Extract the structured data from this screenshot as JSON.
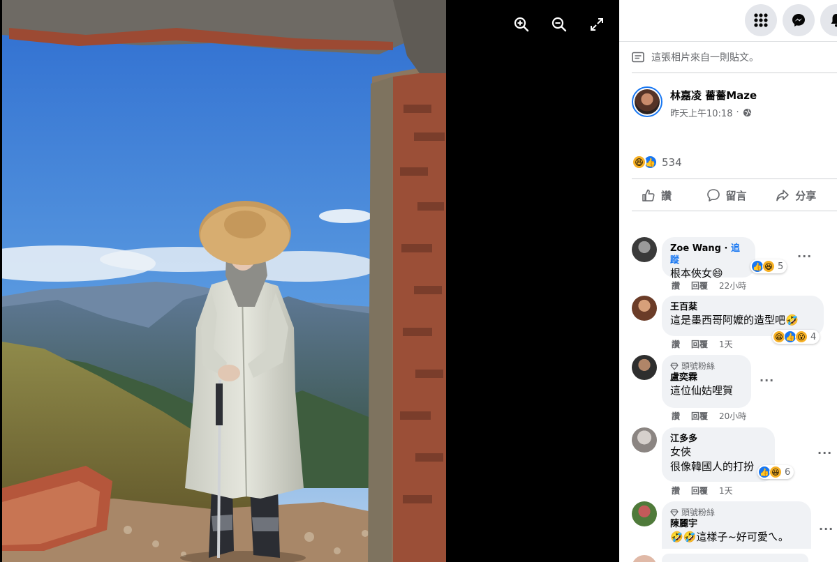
{
  "colors": {
    "accent": "#1877f2",
    "panel_bg": "#ffffff",
    "viewer_bg": "#000000",
    "muted": "#65676b"
  },
  "viewer": {
    "zoom_in_icon": "zoom-in-icon",
    "zoom_out_icon": "zoom-out-icon",
    "fullscreen_icon": "fullscreen-icon"
  },
  "topbar": {
    "icons": [
      "menu-grid-icon",
      "messenger-icon",
      "bell-icon"
    ]
  },
  "post": {
    "source_text": "這張相片來自一則貼文。",
    "author": "林嘉凌 薔薔Maze",
    "time": "昨天上午10:18",
    "reaction_count": "534",
    "actions": {
      "like": "讚",
      "comment": "留言",
      "share": "分享"
    }
  },
  "comments": [
    {
      "name": "Zoe Wang",
      "follow": "追蹤",
      "badge": "",
      "lines": [
        "根本俠女😄"
      ],
      "react_count": "5",
      "like": "讚",
      "reply": "回覆",
      "time": "22小時"
    },
    {
      "name": "王百棻",
      "follow": "",
      "badge": "",
      "lines": [
        "這是墨西哥阿嬤的造型吧🤣"
      ],
      "react_count": "4",
      "like": "讚",
      "reply": "回覆",
      "time": "1天"
    },
    {
      "name": "盧奕霖",
      "follow": "",
      "badge": "頭號粉絲",
      "lines": [
        "這位仙姑哩賀"
      ],
      "react_count": "",
      "like": "讚",
      "reply": "回覆",
      "time": "20小時"
    },
    {
      "name": "江多多",
      "follow": "",
      "badge": "",
      "lines": [
        "女俠",
        "很像韓國人的打扮"
      ],
      "react_count": "6",
      "like": "讚",
      "reply": "回覆",
      "time": "1天"
    },
    {
      "name": "陳麗宇",
      "follow": "",
      "badge": "頭號粉絲",
      "lines": [
        "🤣🤣這樣子~好可愛ㄟ。"
      ],
      "react_count": "",
      "like": "",
      "reply": "",
      "time": ""
    }
  ]
}
